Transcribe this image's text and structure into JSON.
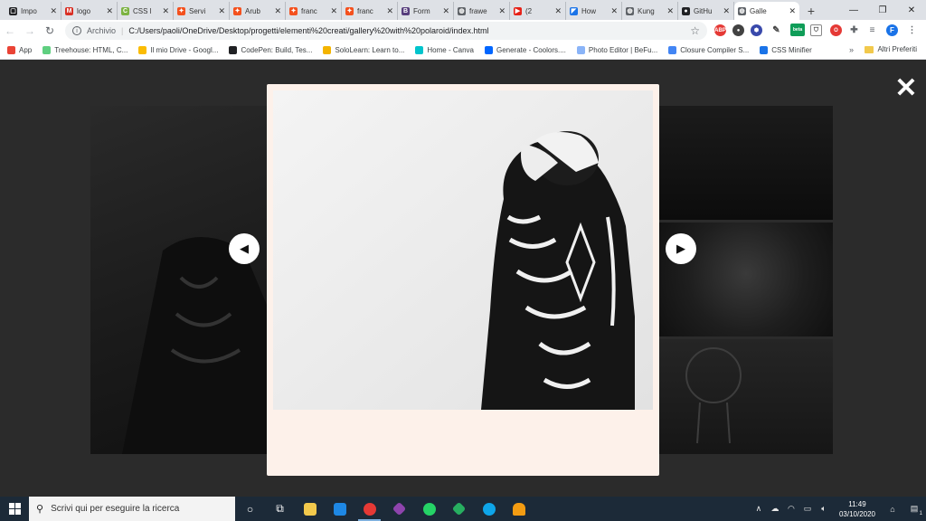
{
  "tabs": [
    {
      "label": "Impo",
      "favicon_color": "#202124",
      "favicon_glyph": "▢"
    },
    {
      "label": "logo",
      "favicon_color": "#d93025",
      "favicon_glyph": "M"
    },
    {
      "label": "CSS l",
      "favicon_color": "#7cb342",
      "favicon_glyph": "C"
    },
    {
      "label": "Servi",
      "favicon_color": "#f4511e",
      "favicon_glyph": "✦"
    },
    {
      "label": "Arub",
      "favicon_color": "#f4511e",
      "favicon_glyph": "✦"
    },
    {
      "label": "franc",
      "favicon_color": "#f4511e",
      "favicon_glyph": "✦"
    },
    {
      "label": "franc",
      "favicon_color": "#f4511e",
      "favicon_glyph": "✦"
    },
    {
      "label": "Form",
      "favicon_color": "#563d7c",
      "favicon_glyph": "B"
    },
    {
      "label": "frawe",
      "favicon_color": "#5f6368",
      "favicon_glyph": "◍"
    },
    {
      "label": "(2",
      "favicon_color": "#e62117",
      "favicon_glyph": "▶"
    },
    {
      "label": "How",
      "favicon_color": "#1a73e8",
      "favicon_glyph": "◤"
    },
    {
      "label": "Kung",
      "favicon_color": "#5f6368",
      "favicon_glyph": "◍"
    },
    {
      "label": "GitHu",
      "favicon_color": "#202124",
      "favicon_glyph": "●"
    },
    {
      "label": "Galle",
      "favicon_color": "#5f6368",
      "favicon_glyph": "◍",
      "active": true
    }
  ],
  "toolbar": {
    "scheme": "Archivio",
    "url": "C:/Users/paoli/OneDrive/Desktop/progetti/elementi%20creati/gallery%20with%20polaroid/index.html",
    "profile_initial": "F",
    "beta_badge": "beta"
  },
  "bookmarks": [
    {
      "label": "App",
      "color": "#ea4335"
    },
    {
      "label": "Treehouse: HTML, C...",
      "color": "#5fcf80"
    },
    {
      "label": "Il mio Drive - Googl...",
      "color": "#fbbc04"
    },
    {
      "label": "CodePen: Build, Tes...",
      "color": "#202124"
    },
    {
      "label": "SoloLearn: Learn to...",
      "color": "#f4b400"
    },
    {
      "label": "Home - Canva",
      "color": "#00c4cc"
    },
    {
      "label": "Generate - Coolors....",
      "color": "#0066ff"
    },
    {
      "label": "Photo Editor | BeFu...",
      "color": "#8ab4f8"
    },
    {
      "label": "Closure Compiler S...",
      "color": "#4285f4"
    },
    {
      "label": "CSS Minifier",
      "color": "#1a73e8"
    }
  ],
  "bookmarks_more": "»",
  "bookmarks_other": "Altri Preferiti",
  "lightbox": {
    "close_glyph": "✕",
    "prev_glyph": "◀",
    "next_glyph": "▶"
  },
  "taskbar": {
    "search_placeholder": "Scrivi qui per eseguire la ricerca",
    "time": "11:49",
    "date": "03/10/2020",
    "notification_count": "1"
  }
}
